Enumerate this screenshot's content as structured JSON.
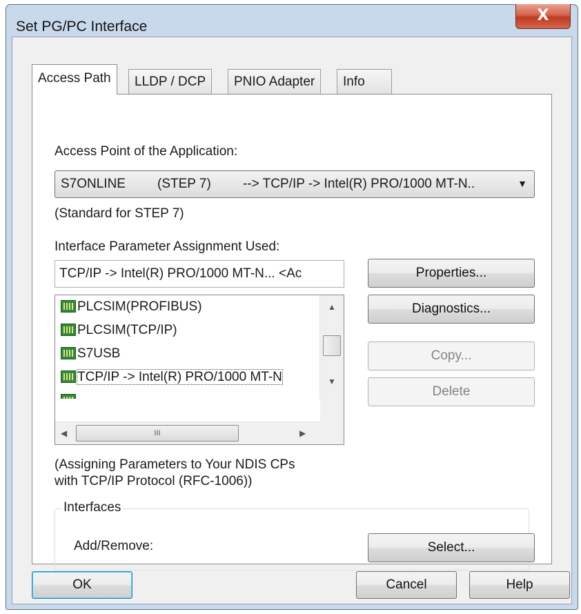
{
  "window": {
    "title": "Set PG/PC Interface",
    "close_glyph": "X"
  },
  "tabs": [
    {
      "label": "Access Path",
      "active": true
    },
    {
      "label": "LLDP / DCP",
      "active": false
    },
    {
      "label": "PNIO Adapter",
      "active": false
    },
    {
      "label": "Info",
      "active": false
    }
  ],
  "access_point": {
    "label": "Access Point of the Application:",
    "value_name": "S7ONLINE",
    "value_app": "(STEP 7)",
    "value_path": "--> TCP/IP -> Intel(R) PRO/1000 MT-N..",
    "note": "(Standard for STEP 7)"
  },
  "interface_param": {
    "label": "Interface Parameter Assignment Used:",
    "value": "TCP/IP -> Intel(R) PRO/1000 MT-N... <Ac",
    "items": [
      {
        "label": "PLCSIM(PROFIBUS)",
        "icon": "network-adapter-icon"
      },
      {
        "label": "PLCSIM(TCP/IP)",
        "icon": "network-adapter-icon"
      },
      {
        "label": "S7USB",
        "icon": "network-adapter-icon"
      },
      {
        "label": "TCP/IP -> Intel(R) PRO/1000 MT-N",
        "icon": "network-adapter-icon",
        "selected": true
      }
    ],
    "description_line1": "(Assigning Parameters to Your NDIS CPs",
    "description_line2": "with TCP/IP Protocol (RFC-1006))"
  },
  "buttons": {
    "properties": "Properties...",
    "diagnostics": "Diagnostics...",
    "copy": "Copy...",
    "delete": "Delete",
    "select": "Select...",
    "ok": "OK",
    "cancel": "Cancel",
    "help": "Help"
  },
  "interfaces": {
    "group_label": "Interfaces",
    "add_remove_label": "Add/Remove:"
  },
  "scrollbar_glyphs": {
    "up": "▲",
    "down": "▼",
    "left": "◀",
    "right": "▶",
    "hthumb_grip": "III",
    "combo_arrow": "▼"
  },
  "colors": {
    "close_button": "#c74a30",
    "window_frame": "#c9d9ec",
    "default_button_border": "#3c7fb1"
  }
}
